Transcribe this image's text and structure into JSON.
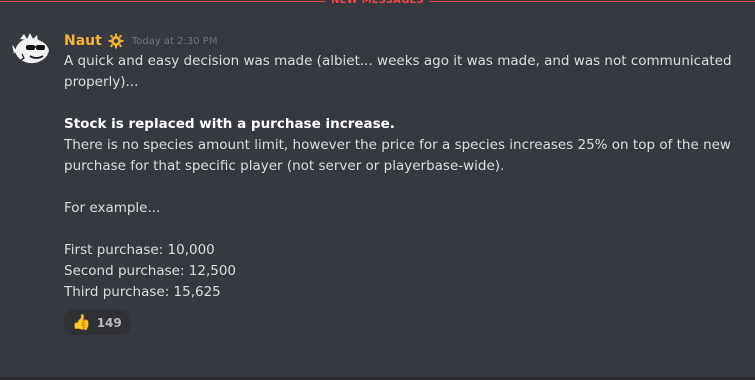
{
  "divider": {
    "label": "NEW MESSAGES"
  },
  "message": {
    "author": "Naut",
    "author_color": "#f0b232",
    "badge_icon": "gear-badge-icon",
    "timestamp": "Today at 2:30 PM",
    "lines": [
      "A quick and easy decision was made (albiet... weeks ago it was made, and was not communicated",
      "properly)..."
    ],
    "bold_heading": "Stock is replaced with a purchase increase.",
    "body_lines": [
      "There is no species amount limit, however the price for a species increases 25% on top of the new",
      "purchase for that specific player (not server or playerbase-wide)."
    ],
    "example_intro": "For example...",
    "examples": [
      "First purchase: 10,000",
      "Second purchase: 12,500",
      "Third purchase: 15,625"
    ]
  },
  "reaction": {
    "emoji": "👍",
    "emoji_name": "thumbs-up-icon",
    "count": "149"
  },
  "colors": {
    "background": "#36393f",
    "new_messages_red": "#f04747",
    "text": "#dcddde",
    "muted": "#72767d"
  }
}
